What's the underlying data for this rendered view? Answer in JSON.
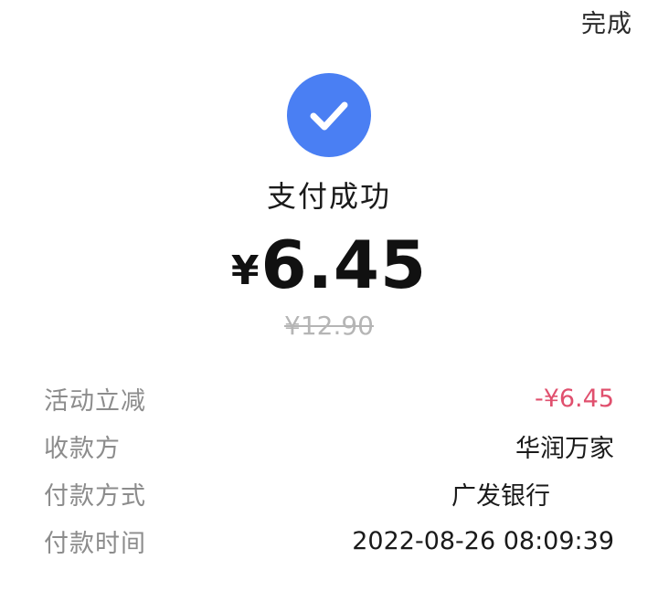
{
  "header": {
    "done_label": "完成"
  },
  "status": {
    "title": "支付成功",
    "currency_symbol": "¥",
    "amount": "6.45",
    "original_price": "¥12.90",
    "icon": "checkmark-icon",
    "accent_color": "#4a7ff3"
  },
  "details": {
    "rows": [
      {
        "label": "活动立减",
        "value": "-¥6.45"
      },
      {
        "label": "收款方",
        "value": "华润万家"
      },
      {
        "label": "付款方式",
        "value": "广发银行"
      },
      {
        "label": "付款时间",
        "value": "2022-08-26 08:09:39"
      }
    ],
    "discount_color": "#e0506e"
  }
}
